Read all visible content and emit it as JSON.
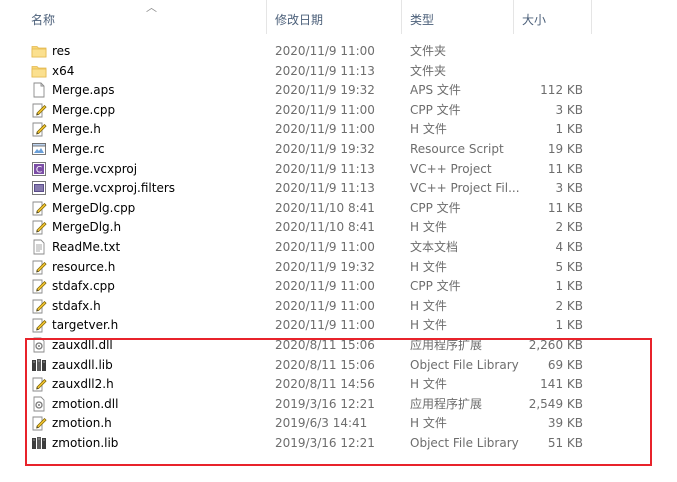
{
  "columns": {
    "name": "名称",
    "date": "修改日期",
    "type": "类型",
    "size": "大小"
  },
  "sort_icon": "sort-ascending-icon",
  "highlight_color": "#e8232b",
  "files": [
    {
      "name": "res",
      "date": "2020/11/9 11:00",
      "type": "文件夹",
      "size": "",
      "icon": "folder"
    },
    {
      "name": "x64",
      "date": "2020/11/9 11:13",
      "type": "文件夹",
      "size": "",
      "icon": "folder"
    },
    {
      "name": "Merge.aps",
      "date": "2020/11/9 19:32",
      "type": "APS 文件",
      "size": "112 KB",
      "icon": "file"
    },
    {
      "name": "Merge.cpp",
      "date": "2020/11/9 11:00",
      "type": "CPP 文件",
      "size": "3 KB",
      "icon": "edit"
    },
    {
      "name": "Merge.h",
      "date": "2020/11/9 11:00",
      "type": "H 文件",
      "size": "1 KB",
      "icon": "edit"
    },
    {
      "name": "Merge.rc",
      "date": "2020/11/9 19:32",
      "type": "Resource Script",
      "size": "19 KB",
      "icon": "rc"
    },
    {
      "name": "Merge.vcxproj",
      "date": "2020/11/9 11:13",
      "type": "VC++ Project",
      "size": "11 KB",
      "icon": "vcxproj"
    },
    {
      "name": "Merge.vcxproj.filters",
      "date": "2020/11/9 11:13",
      "type": "VC++ Project Fil...",
      "size": "3 KB",
      "icon": "filters"
    },
    {
      "name": "MergeDlg.cpp",
      "date": "2020/11/10 8:41",
      "type": "CPP 文件",
      "size": "11 KB",
      "icon": "edit"
    },
    {
      "name": "MergeDlg.h",
      "date": "2020/11/10 8:41",
      "type": "H 文件",
      "size": "2 KB",
      "icon": "edit"
    },
    {
      "name": "ReadMe.txt",
      "date": "2020/11/9 11:00",
      "type": "文本文档",
      "size": "4 KB",
      "icon": "text"
    },
    {
      "name": "resource.h",
      "date": "2020/11/9 19:32",
      "type": "H 文件",
      "size": "5 KB",
      "icon": "edit"
    },
    {
      "name": "stdafx.cpp",
      "date": "2020/11/9 11:00",
      "type": "CPP 文件",
      "size": "1 KB",
      "icon": "edit"
    },
    {
      "name": "stdafx.h",
      "date": "2020/11/9 11:00",
      "type": "H 文件",
      "size": "2 KB",
      "icon": "edit"
    },
    {
      "name": "targetver.h",
      "date": "2020/11/9 11:00",
      "type": "H 文件",
      "size": "1 KB",
      "icon": "edit"
    },
    {
      "name": "zauxdll.dll",
      "date": "2020/8/11 15:06",
      "type": "应用程序扩展",
      "size": "2,260 KB",
      "icon": "dll"
    },
    {
      "name": "zauxdll.lib",
      "date": "2020/8/11 15:06",
      "type": "Object File Library",
      "size": "69 KB",
      "icon": "lib"
    },
    {
      "name": "zauxdll2.h",
      "date": "2020/8/11 14:56",
      "type": "H 文件",
      "size": "141 KB",
      "icon": "edit"
    },
    {
      "name": "zmotion.dll",
      "date": "2019/3/16 12:21",
      "type": "应用程序扩展",
      "size": "2,549 KB",
      "icon": "dll"
    },
    {
      "name": "zmotion.h",
      "date": "2019/6/3 14:41",
      "type": "H 文件",
      "size": "39 KB",
      "icon": "edit"
    },
    {
      "name": "zmotion.lib",
      "date": "2019/3/16 12:21",
      "type": "Object File Library",
      "size": "51 KB",
      "icon": "lib"
    }
  ]
}
